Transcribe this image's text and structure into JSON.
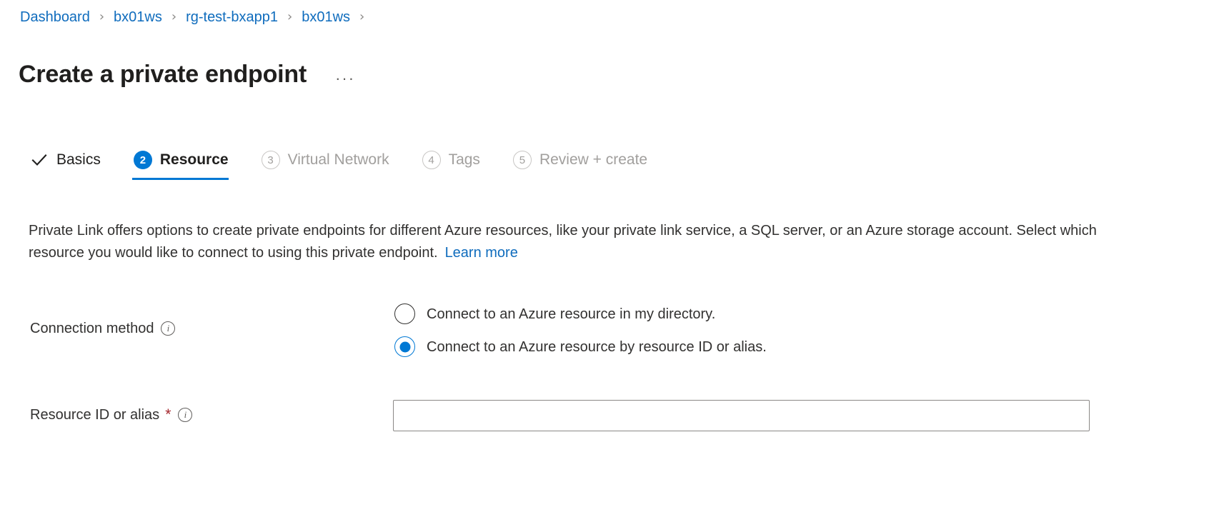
{
  "breadcrumb": {
    "separator": "›",
    "items": [
      {
        "label": "Dashboard"
      },
      {
        "label": "bx01ws"
      },
      {
        "label": "rg-test-bxapp1"
      },
      {
        "label": "bx01ws"
      }
    ]
  },
  "header": {
    "title": "Create a private endpoint",
    "more_menu": "···",
    "more_menu_name": "more-options-icon"
  },
  "tabs": [
    {
      "label": "Basics",
      "badge": "✓",
      "state": "done",
      "icon": "check-icon"
    },
    {
      "label": "Resource",
      "badge": "2",
      "state": "active",
      "icon": "step-number-2"
    },
    {
      "label": "Virtual Network",
      "badge": "3",
      "state": "disabled",
      "icon": "step-number-3"
    },
    {
      "label": "Tags",
      "badge": "4",
      "state": "disabled",
      "icon": "step-number-4"
    },
    {
      "label": "Review + create",
      "badge": "5",
      "state": "disabled",
      "icon": "step-number-5"
    }
  ],
  "description": {
    "text": "Private Link offers options to create private endpoints for different Azure resources, like your private link service, a SQL server, or an Azure storage account. Select which resource you would like to connect to using this private endpoint.",
    "learn_more": "Learn more"
  },
  "form": {
    "connection_method": {
      "label": "Connection method",
      "info_tooltip_icon": "info-icon",
      "options": [
        {
          "label": "Connect to an Azure resource in my directory.",
          "checked": false
        },
        {
          "label": "Connect to an Azure resource by resource ID or alias.",
          "checked": true
        }
      ]
    },
    "resource_id": {
      "label": "Resource ID or alias",
      "required_marker": "*",
      "info_tooltip_icon": "info-icon",
      "value": "",
      "placeholder": ""
    }
  },
  "colors": {
    "accent": "#0078d4",
    "link": "#0f6cbd",
    "required": "#a4262c",
    "text": "#323130",
    "disabled_text": "#a19f9d",
    "border": "#8a8886"
  }
}
